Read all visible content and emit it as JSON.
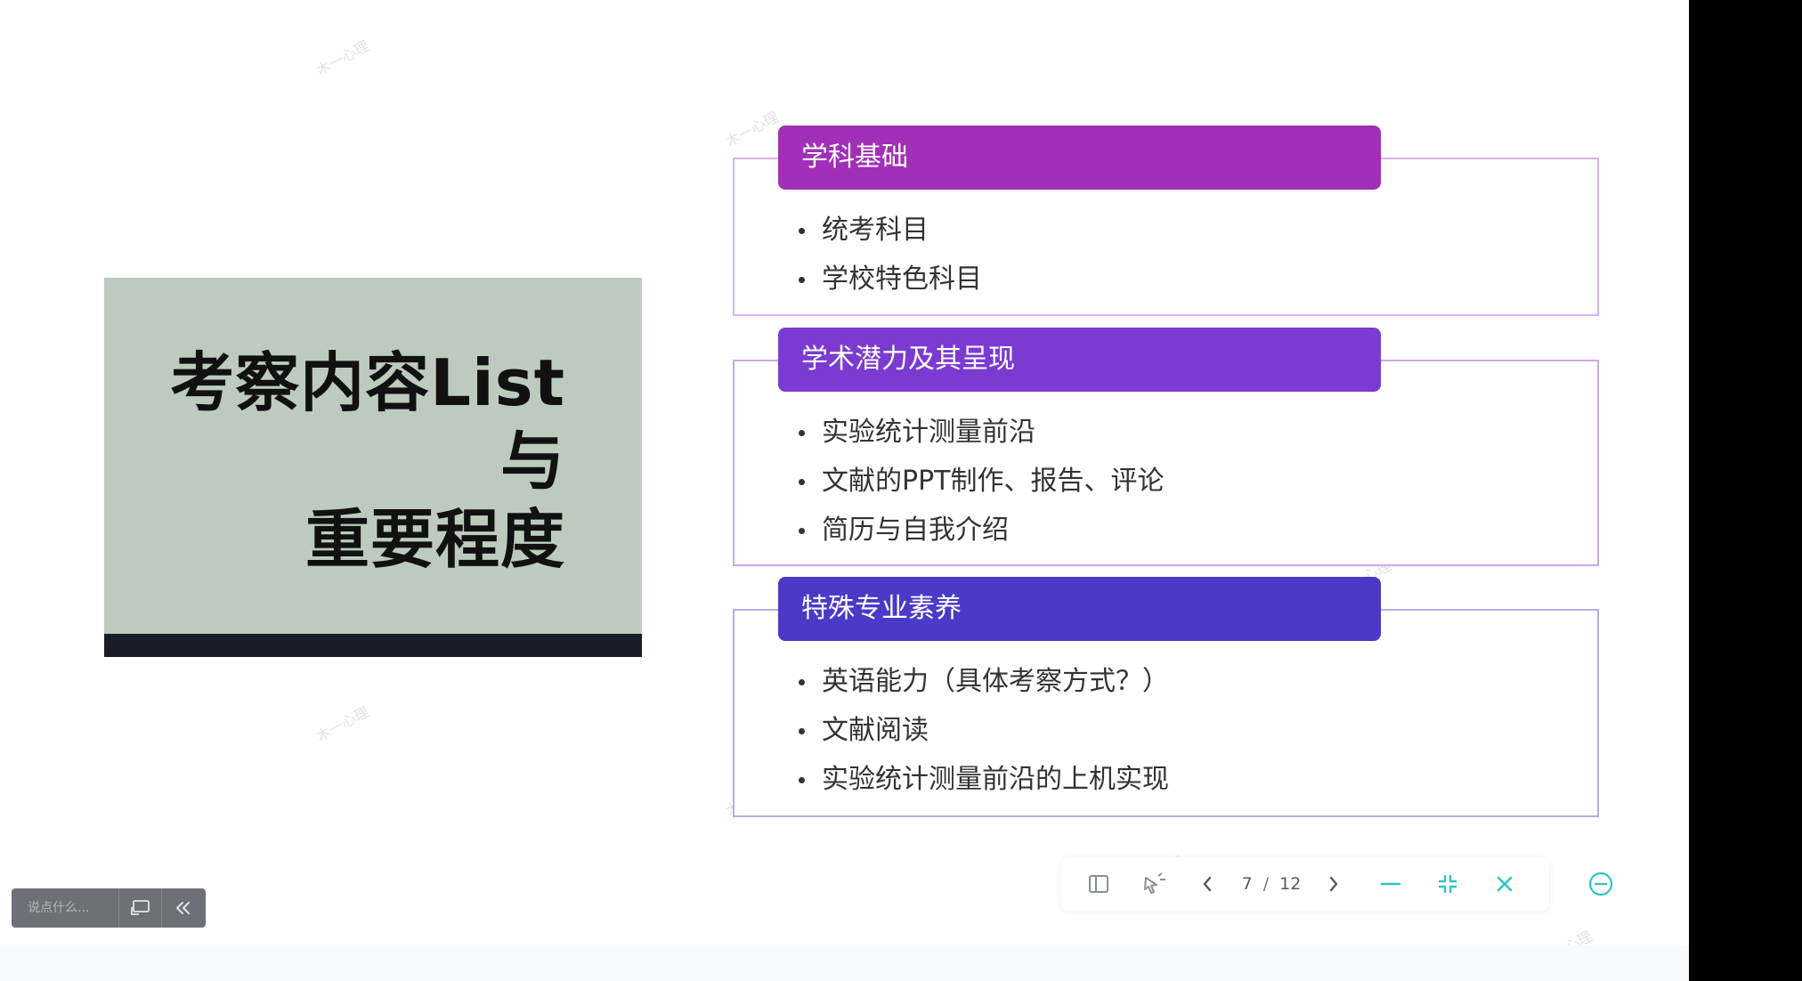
{
  "title_card": {
    "line1": "考察内容List",
    "line2": "与",
    "line3": "重要程度"
  },
  "sections": [
    {
      "title": "学科基础",
      "items": [
        "统考科目",
        "学校特色科目"
      ],
      "color": "#a12fb8"
    },
    {
      "title": "学术潜力及其呈现",
      "items": [
        "实验统计测量前沿",
        "文献的PPT制作、报告、评论",
        "简历与自我介绍"
      ],
      "color": "#7b3bd0"
    },
    {
      "title": "特殊专业素养",
      "items": [
        "英语能力（具体考察方式？）",
        "文献阅读",
        "实验统计测量前沿的上机实现"
      ],
      "color": "#4a3ac8"
    }
  ],
  "watermark": "木一心理",
  "chat": {
    "placeholder": "说点什么..."
  },
  "toolbar": {
    "current_page": "7",
    "separator": "/",
    "total_pages": "12",
    "icons": {
      "sidebar": "sidebar-panel-icon",
      "laser": "laser-pointer-icon",
      "prev": "chevron-left-icon",
      "next": "chevron-right-icon",
      "minimize": "minus-icon",
      "exit_fullscreen": "exit-fullscreen-icon",
      "close": "close-icon",
      "more": "more-circle-icon"
    },
    "accent_color": "#2cc6c0"
  }
}
